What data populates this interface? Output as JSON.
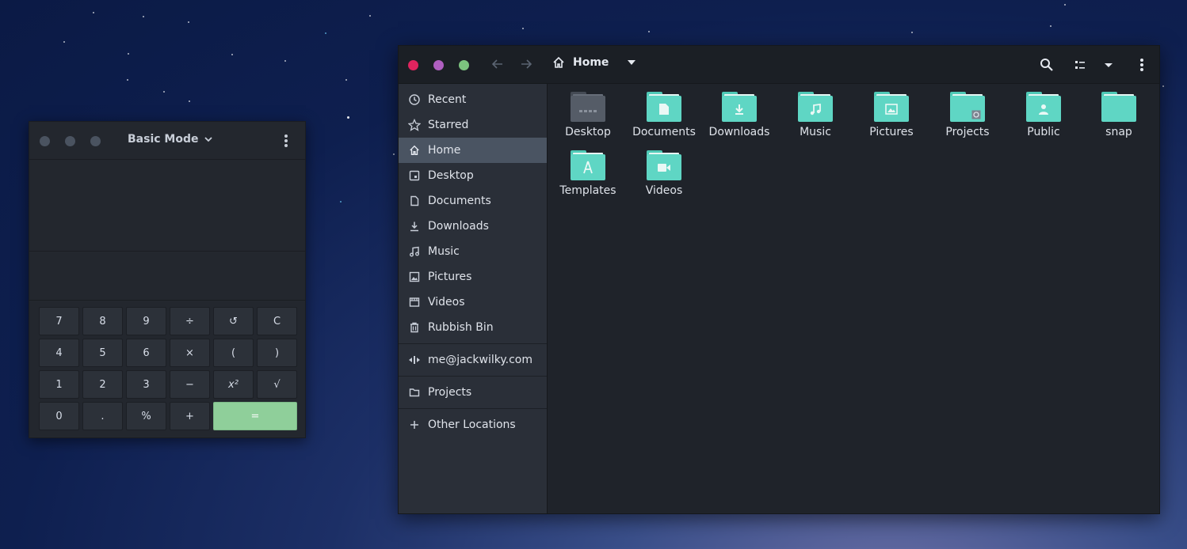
{
  "calculator": {
    "mode_label": "Basic Mode",
    "keys": [
      "7",
      "8",
      "9",
      "÷",
      "↺",
      "C",
      "4",
      "5",
      "6",
      "×",
      "(",
      ")",
      "1",
      "2",
      "3",
      "−",
      "x²",
      "√",
      "0",
      ".",
      "%",
      "+",
      "="
    ]
  },
  "files": {
    "path_title": "Home",
    "sidebar": [
      {
        "label": "Recent",
        "icon": "clock-icon"
      },
      {
        "label": "Starred",
        "icon": "star-icon"
      },
      {
        "label": "Home",
        "icon": "home-icon",
        "active": true
      },
      {
        "label": "Desktop",
        "icon": "desktop-icon"
      },
      {
        "label": "Documents",
        "icon": "document-icon"
      },
      {
        "label": "Downloads",
        "icon": "download-icon"
      },
      {
        "label": "Music",
        "icon": "music-icon"
      },
      {
        "label": "Pictures",
        "icon": "picture-icon"
      },
      {
        "label": "Videos",
        "icon": "video-icon"
      },
      {
        "label": "Rubbish Bin",
        "icon": "trash-icon"
      },
      {
        "label": "me@jackwilky.com",
        "icon": "network-icon"
      },
      {
        "label": "Projects",
        "icon": "folder-icon"
      },
      {
        "label": "Other Locations",
        "icon": "plus-icon"
      }
    ],
    "items": [
      {
        "label": "Desktop",
        "icon": "desktop-folder-icon"
      },
      {
        "label": "Documents",
        "icon": "documents-folder-icon"
      },
      {
        "label": "Downloads",
        "icon": "downloads-folder-icon"
      },
      {
        "label": "Music",
        "icon": "music-folder-icon"
      },
      {
        "label": "Pictures",
        "icon": "pictures-folder-icon"
      },
      {
        "label": "Projects",
        "icon": "projects-folder-icon"
      },
      {
        "label": "Public",
        "icon": "public-folder-icon"
      },
      {
        "label": "snap",
        "icon": "folder-icon"
      },
      {
        "label": "Templates",
        "icon": "templates-folder-icon"
      },
      {
        "label": "Videos",
        "icon": "videos-folder-icon"
      }
    ]
  },
  "colors": {
    "close": "#e0245e",
    "minimize": "#b05fc1",
    "maximize": "#7cc47f",
    "folder_accent": "#5fd6c4",
    "equals_key": "#8fcf9a"
  }
}
